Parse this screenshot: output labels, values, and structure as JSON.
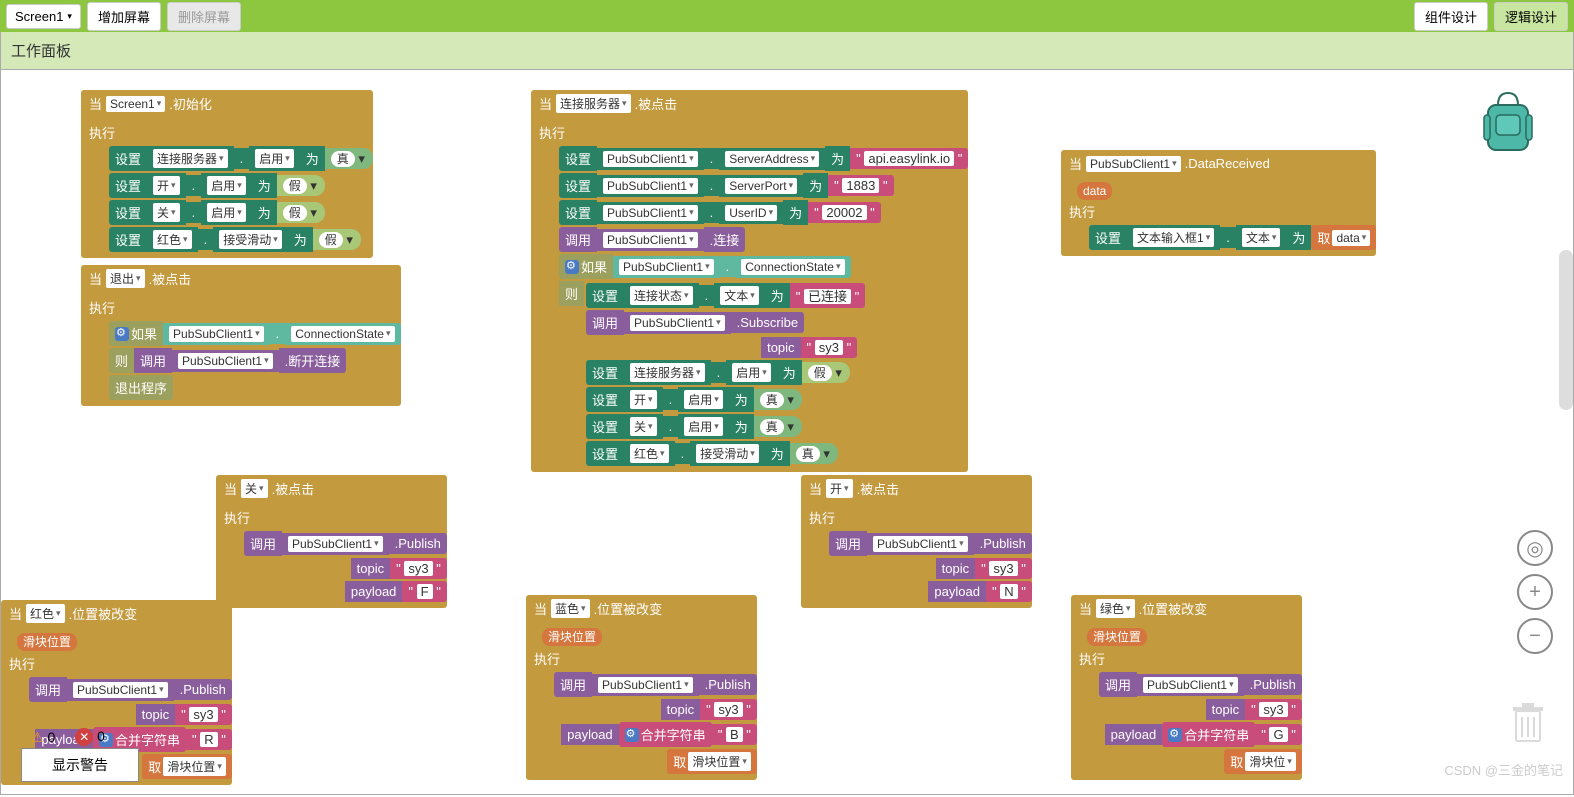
{
  "toolbar": {
    "screen_selector": "Screen1",
    "add_screen": "增加屏幕",
    "remove_screen": "删除屏幕",
    "component_design": "组件设计",
    "logic_design": "逻辑设计"
  },
  "panel_title": "工作面板",
  "blocks": {
    "init": {
      "when": "当",
      "target": "Screen1",
      "event": ".初始化",
      "exec": "执行",
      "rows": [
        {
          "set": "设置",
          "comp": "连接服务器",
          "dot": ".",
          "prop": "启用",
          "to": "为",
          "val": "真"
        },
        {
          "set": "设置",
          "comp": "开",
          "dot": ".",
          "prop": "启用",
          "to": "为",
          "val": "假"
        },
        {
          "set": "设置",
          "comp": "关",
          "dot": ".",
          "prop": "启用",
          "to": "为",
          "val": "假"
        },
        {
          "set": "设置",
          "comp": "红色",
          "dot": ".",
          "prop": "接受滑动",
          "to": "为",
          "val": "假"
        }
      ]
    },
    "exit": {
      "when": "当",
      "target": "退出",
      "event": ".被点击",
      "exec": "执行",
      "if": "如果",
      "comp": "PubSubClient1",
      "prop": "ConnectionState",
      "then": "则",
      "call": "调用",
      "call_comp": "PubSubClient1",
      "method": ".断开连接",
      "exit_app": "退出程序"
    },
    "connect": {
      "when": "当",
      "target": "连接服务器",
      "event": ".被点击",
      "exec": "执行",
      "r1": {
        "set": "设置",
        "comp": "PubSubClient1",
        "prop": "ServerAddress",
        "to": "为",
        "val": "api.easylink.io"
      },
      "r2": {
        "set": "设置",
        "comp": "PubSubClient1",
        "prop": "ServerPort",
        "to": "为",
        "val": "1883"
      },
      "r3": {
        "set": "设置",
        "comp": "PubSubClient1",
        "prop": "UserID",
        "to": "为",
        "val": "20002"
      },
      "r4": {
        "call": "调用",
        "comp": "PubSubClient1",
        "method": ".连接"
      },
      "if": "如果",
      "if_comp": "PubSubClient1",
      "if_prop": "ConnectionState",
      "then": "则",
      "r5": {
        "set": "设置",
        "comp": "连接状态",
        "prop": "文本",
        "to": "为",
        "val": "已连接"
      },
      "r6": {
        "call": "调用",
        "comp": "PubSubClient1",
        "method": ".Subscribe",
        "param": "topic",
        "val": "sy3"
      },
      "r7": {
        "set": "设置",
        "comp": "连接服务器",
        "prop": "启用",
        "to": "为",
        "val": "假"
      },
      "r8": {
        "set": "设置",
        "comp": "开",
        "prop": "启用",
        "to": "为",
        "val": "真"
      },
      "r9": {
        "set": "设置",
        "comp": "关",
        "prop": "启用",
        "to": "为",
        "val": "真"
      },
      "r10": {
        "set": "设置",
        "comp": "红色",
        "prop": "接受滑动",
        "to": "为",
        "val": "真"
      }
    },
    "data_recv": {
      "when": "当",
      "target": "PubSubClient1",
      "event": ".DataReceived",
      "param": "data",
      "exec": "执行",
      "set": "设置",
      "comp": "文本输入框1",
      "prop": "文本",
      "to": "为",
      "get": "取",
      "get_var": "data"
    },
    "off_click": {
      "when": "当",
      "target": "关",
      "event": ".被点击",
      "exec": "执行",
      "call": "调用",
      "comp": "PubSubClient1",
      "method": ".Publish",
      "topic": "topic",
      "topic_val": "sy3",
      "payload": "payload",
      "payload_val": "F"
    },
    "on_click": {
      "when": "当",
      "target": "开",
      "event": ".被点击",
      "exec": "执行",
      "call": "调用",
      "comp": "PubSubClient1",
      "method": ".Publish",
      "topic": "topic",
      "topic_val": "sy3",
      "payload": "payload",
      "payload_val": "N"
    },
    "red_pos": {
      "when": "当",
      "target": "红色",
      "event": ".位置被改变",
      "param": "滑块位置",
      "exec": "执行",
      "call": "调用",
      "comp": "PubSubClient1",
      "method": ".Publish",
      "topic": "topic",
      "topic_val": "sy3",
      "payload": "payload",
      "join": "合并字符串",
      "join_val": "R",
      "get": "取",
      "get_var": "滑块位置"
    },
    "blue_pos": {
      "when": "当",
      "target": "蓝色",
      "event": ".位置被改变",
      "param": "滑块位置",
      "exec": "执行",
      "call": "调用",
      "comp": "PubSubClient1",
      "method": ".Publish",
      "topic": "topic",
      "topic_val": "sy3",
      "payload": "payload",
      "join": "合并字符串",
      "join_val": "B",
      "get": "取",
      "get_var": "滑块位置"
    },
    "green_pos": {
      "when": "当",
      "target": "绿色",
      "event": ".位置被改变",
      "param": "滑块位置",
      "exec": "执行",
      "call": "调用",
      "comp": "PubSubClient1",
      "method": ".Publish",
      "topic": "topic",
      "topic_val": "sy3",
      "payload": "payload",
      "join": "合并字符串",
      "join_val": "G",
      "get": "取",
      "get_var": "滑块位"
    }
  },
  "status": {
    "warnings": "0",
    "errors": "0"
  },
  "warning_box": "显示警告",
  "watermark": "CSDN @三金的笔记"
}
